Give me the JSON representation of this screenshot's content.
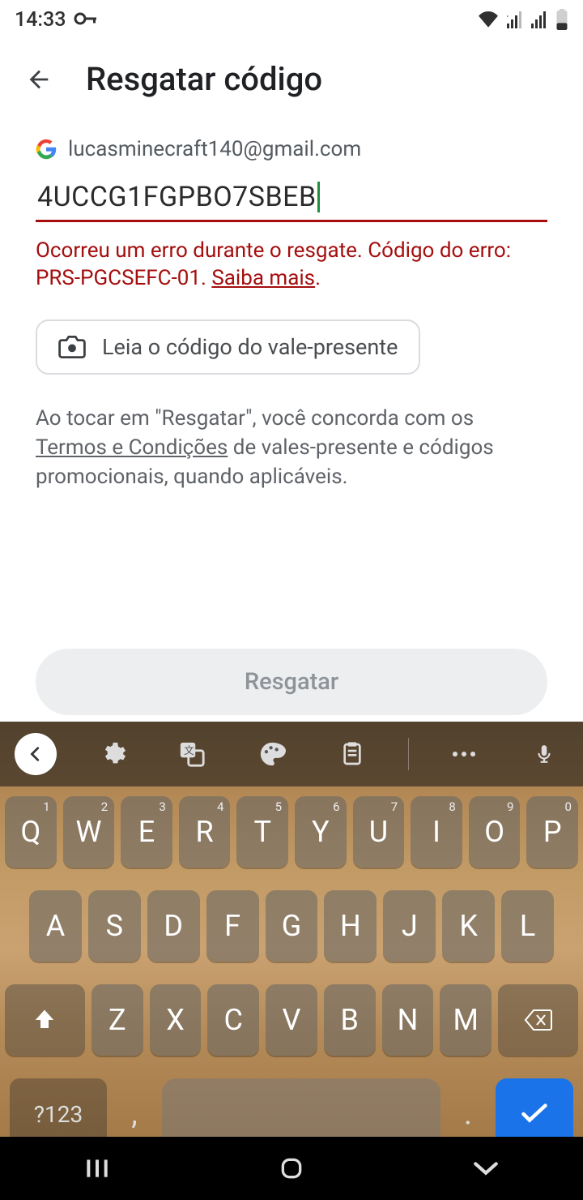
{
  "status": {
    "time": "14:33"
  },
  "header": {
    "title": "Resgatar código"
  },
  "account": {
    "email": "lucasminecraft140@gmail.com"
  },
  "code": {
    "value": "4UCCG1FGPBO7SBEB"
  },
  "error": {
    "prefix": "Ocorreu um erro durante o resgate. Código do erro: PRS-PGCSEFC-01. ",
    "link": "Saiba mais",
    "suffix": "."
  },
  "scan": {
    "label": "Leia o código do vale-presente"
  },
  "terms": {
    "prefix": "Ao tocar em \"Resgatar\", você concorda com os ",
    "link": "Termos e Condições",
    "suffix": " de vales-presente e códigos promocionais, quando aplicáveis."
  },
  "redeem": {
    "label": "Resgatar"
  },
  "keyboard": {
    "row1": [
      {
        "k": "Q",
        "h": "1"
      },
      {
        "k": "W",
        "h": "2"
      },
      {
        "k": "E",
        "h": "3"
      },
      {
        "k": "R",
        "h": "4"
      },
      {
        "k": "T",
        "h": "5"
      },
      {
        "k": "Y",
        "h": "6"
      },
      {
        "k": "U",
        "h": "7"
      },
      {
        "k": "I",
        "h": "8"
      },
      {
        "k": "O",
        "h": "9"
      },
      {
        "k": "P",
        "h": "0"
      }
    ],
    "row2": [
      {
        "k": "A"
      },
      {
        "k": "S"
      },
      {
        "k": "D"
      },
      {
        "k": "F"
      },
      {
        "k": "G"
      },
      {
        "k": "H"
      },
      {
        "k": "J"
      },
      {
        "k": "K"
      },
      {
        "k": "L"
      }
    ],
    "row3": [
      {
        "k": "Z"
      },
      {
        "k": "X"
      },
      {
        "k": "C"
      },
      {
        "k": "V"
      },
      {
        "k": "B"
      },
      {
        "k": "N"
      },
      {
        "k": "M"
      }
    ],
    "sym": "?123",
    "comma": ",",
    "dot": "."
  }
}
